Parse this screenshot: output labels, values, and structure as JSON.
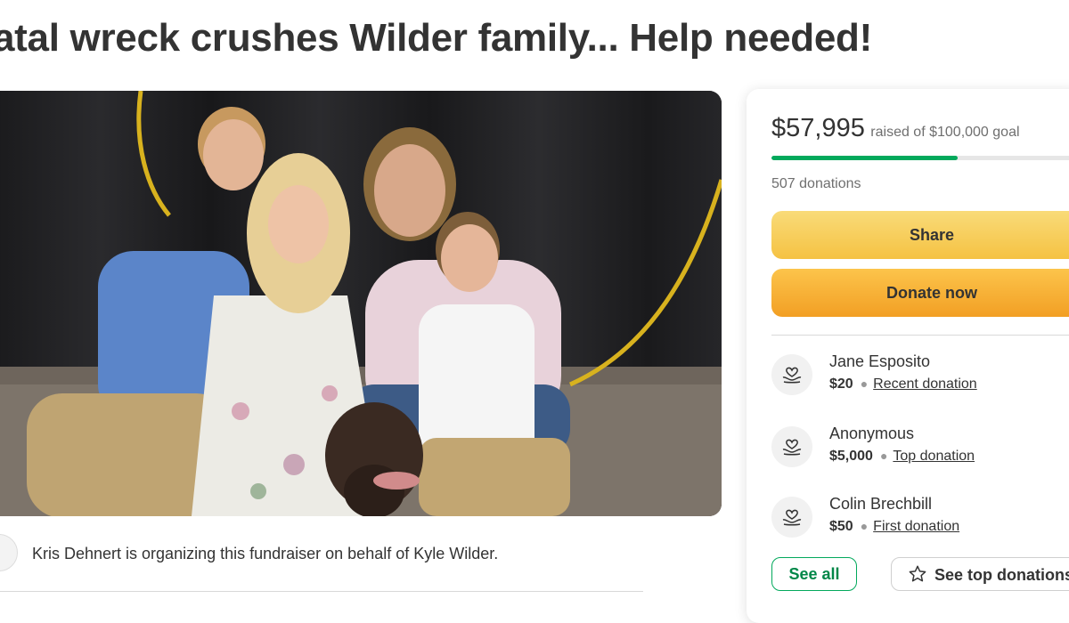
{
  "page": {
    "title": "atal wreck crushes Wilder family... Help needed!"
  },
  "organizer": {
    "text": "Kris Dehnert is organizing this fundraiser on behalf of Kyle Wilder."
  },
  "fundraiser": {
    "amount_raised": "$57,995",
    "goal_text": "raised of $100,000 goal",
    "progress_fraction": 0.58,
    "donation_count": "507 donations",
    "share_label": "Share",
    "donate_label": "Donate now"
  },
  "donors": [
    {
      "name": "Jane Esposito",
      "amount": "$20",
      "tag": "Recent donation",
      "icon": "heart-hands-icon"
    },
    {
      "name": "Anonymous",
      "amount": "$5,000",
      "tag": "Top donation",
      "icon": "heart-hands-icon"
    },
    {
      "name": "Colin Brechbill",
      "amount": "$50",
      "tag": "First donation",
      "icon": "heart-hands-icon"
    }
  ],
  "actions": {
    "see_all_label": "See all",
    "see_top_label": "See top donations",
    "see_top_icon": "star-icon"
  },
  "colors": {
    "brand_green": "#02a95c",
    "share_yellow": "#f7cf5b",
    "donate_orange": "#f5a52c"
  }
}
